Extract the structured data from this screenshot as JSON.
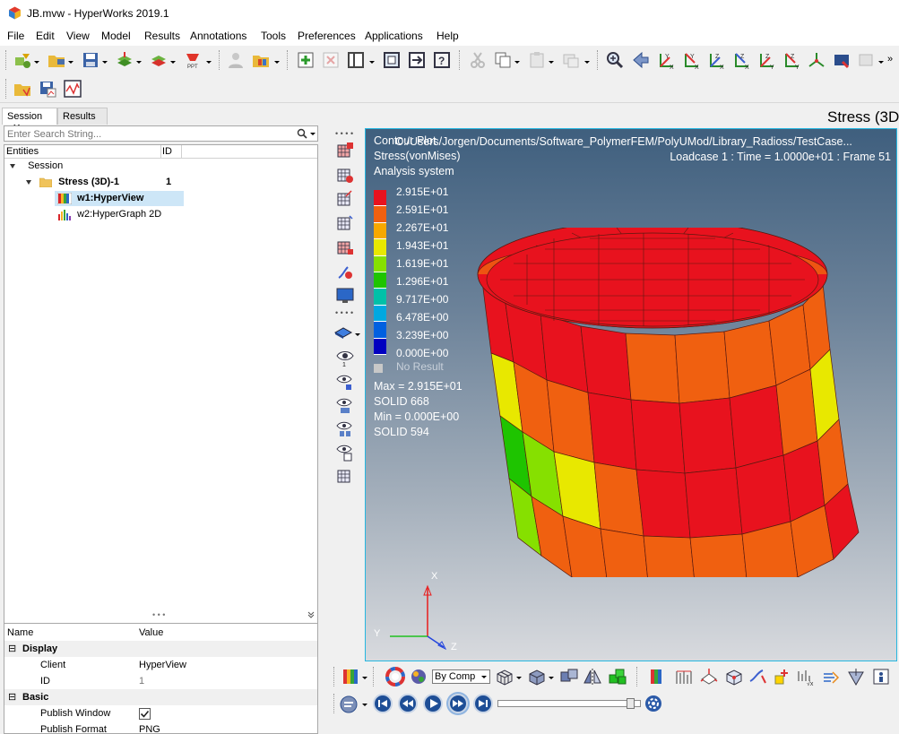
{
  "window": {
    "title": "JB.mvw - HyperWorks 2019.1"
  },
  "menu": [
    "File",
    "Edit",
    "View",
    "Model",
    "Results",
    "Annotations",
    "Tools",
    "Preferences",
    "Applications",
    "Help"
  ],
  "left_panel": {
    "tabs": [
      {
        "label": "Session",
        "close": "✕"
      },
      {
        "label": "Results"
      }
    ],
    "search_placeholder": "Enter Search String...",
    "tree_headers": {
      "entities": "Entities",
      "id": "ID"
    },
    "tree": [
      {
        "label": "Session",
        "id": ""
      },
      {
        "label": "Stress (3D)-1",
        "id": "1"
      },
      {
        "label": "w1:HyperView",
        "id": ""
      },
      {
        "label": "w2:HyperGraph 2D",
        "id": ""
      }
    ],
    "properties": {
      "headers": {
        "name": "Name",
        "value": "Value"
      },
      "groups": [
        {
          "label": "Display",
          "rows": [
            {
              "name": "Client",
              "value": "HyperView"
            },
            {
              "name": "ID",
              "value": "1"
            }
          ]
        },
        {
          "label": "Basic",
          "rows": [
            {
              "name": "Publish Window",
              "checked": true
            },
            {
              "name": "Publish Format",
              "value": "PNG"
            }
          ]
        }
      ],
      "expanders": {
        "collapsed": "⊟"
      }
    }
  },
  "page_title": "Stress (3D",
  "viewport": {
    "header_line1": "Contour Plot",
    "path": "C:/Users/Jorgen/Documents/Software_PolymerFEM/PolyUMod/Library_Radioss/TestCase...",
    "result_type": "Stress(vonMises)",
    "system": "Analysis system",
    "loadcase": "Loadcase 1 : Time = 1.0000e+01 : Frame 51",
    "legend": {
      "values": [
        "2.915E+01",
        "2.591E+01",
        "2.267E+01",
        "1.943E+01",
        "1.619E+01",
        "1.296E+01",
        "9.717E+00",
        "6.478E+00",
        "3.239E+00",
        "0.000E+00"
      ],
      "colors": [
        "#e8121e",
        "#f06010",
        "#f7a800",
        "#e8e800",
        "#86e000",
        "#1ec400",
        "#00c0a8",
        "#00a8e0",
        "#0060e0",
        "#0000c0"
      ],
      "no_result": "No Result"
    },
    "stats": [
      "Max =  2.915E+01",
      "SOLID 668",
      "Min =  0.000E+00",
      "SOLID 594"
    ],
    "triad": {
      "x": "X",
      "y": "Y",
      "z": "Z"
    }
  },
  "bottom_toolbar": {
    "comp_select": "By Comp"
  },
  "colors": {
    "viewport_border": "#26b7e0",
    "hot": "#e8121e",
    "selection": "#cde6f7"
  }
}
